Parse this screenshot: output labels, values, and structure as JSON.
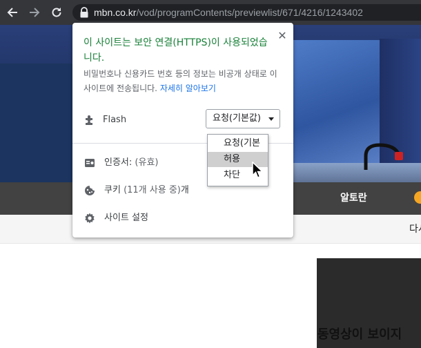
{
  "browser": {
    "url_host": "mbn.co.kr",
    "url_path": "/vod/programContents/previewlist/671/4216/1243402"
  },
  "page": {
    "nav_label": "알토란",
    "sub_text": "다시",
    "video_message": "동영상이 보이지"
  },
  "site_info": {
    "title": "이 사이트는 보안 연결(HTTPS)이 사용되었습니다.",
    "description": "비밀번호나 신용카드 번호 등의 정보는 비공개 상태로 이 사이트에 전송됩니다.",
    "learn_more": "자세히 알아보기",
    "close_glyph": "✕",
    "flash": {
      "label": "Flash",
      "selected": "요청(기본값)",
      "options": [
        "요청(기본값)",
        "허용",
        "차단"
      ],
      "highlighted": "허용"
    },
    "certificate": {
      "label": "인증서: ",
      "status": "(유효)"
    },
    "cookies": {
      "label": "쿠키 ",
      "count": "(11개 사용 중)",
      "suffix": "개"
    },
    "site_settings": "사이트 설정"
  },
  "colors": {
    "secure_title": "#188038",
    "link": "#1a73e8",
    "toolbar": "#35363a",
    "navbar": "#424242"
  }
}
